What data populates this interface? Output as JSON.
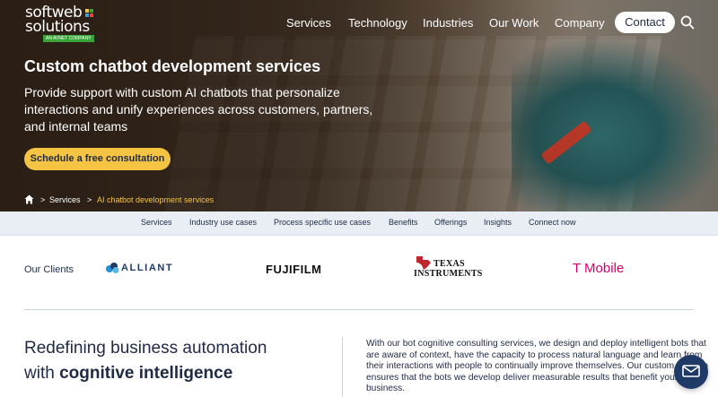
{
  "brand": {
    "name_line1": "softweb",
    "name_line2": "solutions",
    "tagline": "AN AVNET COMPANY",
    "colors": {
      "accent": "#f6c443",
      "navy": "#1f2a44",
      "green": "#3aa33a"
    }
  },
  "nav": {
    "items": [
      "Services",
      "Technology",
      "Industries",
      "Our Work",
      "Company"
    ],
    "active": "Company",
    "contact_label": "Contact",
    "search_icon": "search-icon"
  },
  "hero": {
    "title": "Custom chatbot development services",
    "subtitle": "Provide support with custom AI chatbots that personalize interactions and unify experiences across customers, partners, and internal teams",
    "cta_label": "Schedule a free consultation"
  },
  "breadcrumb": {
    "home_icon": "home-icon",
    "sep": ">",
    "items": [
      "Services",
      "AI chatbot development services"
    ]
  },
  "subnav": {
    "items": [
      "Services",
      "Industry use cases",
      "Process specific use cases",
      "Benefits",
      "Offerings",
      "Insights",
      "Connect now"
    ]
  },
  "clients": {
    "label": "Our Clients",
    "logos": {
      "alliant": "ALLIANT",
      "fujifilm": "FUJIFILM",
      "ti_line1": "TEXAS",
      "ti_line2": "INSTRUMENTS",
      "tmobile": "T Mobile"
    }
  },
  "section": {
    "heading_line1": "Redefining business automation",
    "heading_line2_pre": "with ",
    "heading_line2_bold": "cognitive intelligence",
    "body": "With our bot cognitive consulting services, we design and deploy intelligent bots that are aware of context, have the capacity to process natural language and learn from their interactions with people to continually improve themselves. Our custom solution ensures that the bots we develop deliver measurable results that benefit your business."
  },
  "chat_widget": {
    "icon": "mail-icon"
  }
}
